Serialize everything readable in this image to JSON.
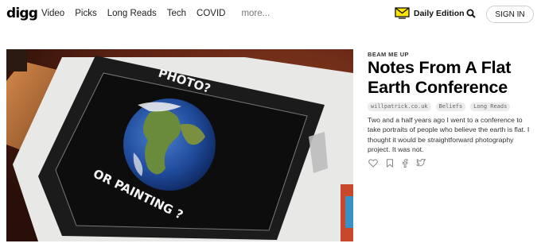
{
  "header": {
    "logo": "digg",
    "nav": [
      "Video",
      "Picks",
      "Long Reads",
      "Tech",
      "COVID"
    ],
    "more": "more...",
    "daily_edition": "Daily Edition",
    "signin": "SIGN IN"
  },
  "hero": {
    "photo_text_top": "PHOTO?",
    "photo_text_bottom": "OR PAINTING ?"
  },
  "article": {
    "kicker": "BEAM ME UP",
    "title": "Notes From A Flat Earth Conference",
    "tags": [
      "willpatrick.co.uk",
      "Beliefs",
      "Long Reads"
    ],
    "description": "Two and a half years ago I went to a conference to take portraits of people who believe the earth is flat. I thought it would be straightforward photography project. It was not.",
    "actions": [
      "heart-icon",
      "bookmark-icon",
      "facebook-icon",
      "twitter-icon"
    ]
  },
  "colors": {
    "accent_yellow": "#ffe500",
    "text": "#111111",
    "tag_bg": "#ececec"
  }
}
